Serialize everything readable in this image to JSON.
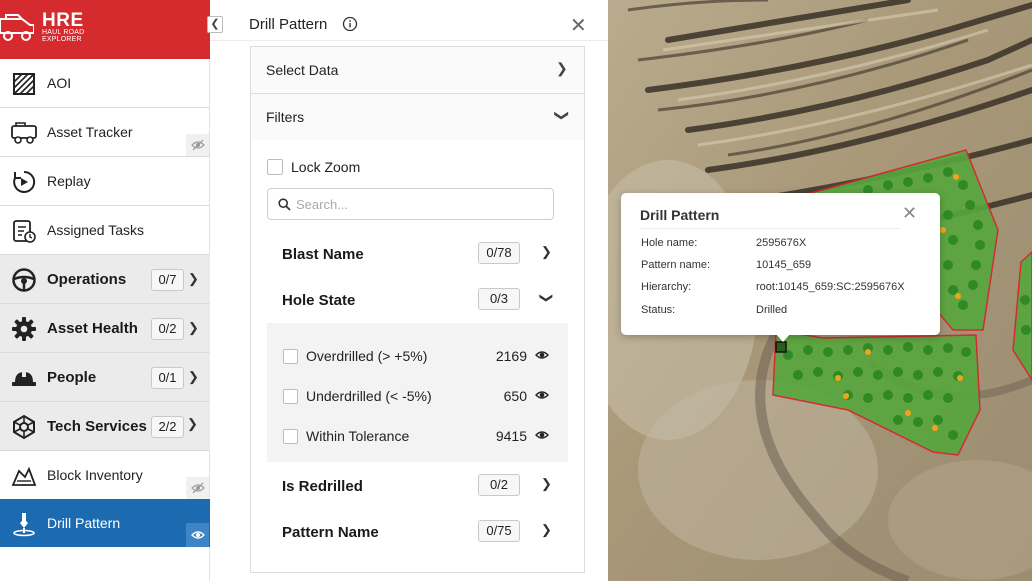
{
  "brand": {
    "name": "HRE",
    "subtitle": "HAUL ROAD EXPLORER"
  },
  "sidebar": {
    "items": [
      {
        "label": "AOI",
        "icon": "aoi-hatch-icon"
      },
      {
        "label": "Asset Tracker",
        "icon": "truck-icon",
        "visibility": "hidden"
      },
      {
        "label": "Replay",
        "icon": "replay-icon"
      },
      {
        "label": "Assigned Tasks",
        "icon": "clipboard-icon"
      },
      {
        "label": "Operations",
        "icon": "steering-wheel-icon",
        "count": "0/7",
        "chevron": "right"
      },
      {
        "label": "Asset Health",
        "icon": "gear-icon",
        "count": "0/2",
        "chevron": "right"
      },
      {
        "label": "People",
        "icon": "hard-hat-icon",
        "count": "0/1",
        "chevron": "right"
      },
      {
        "label": "Tech Services",
        "icon": "tech-services-icon",
        "count": "2/2",
        "chevron": "down"
      },
      {
        "label": "Block Inventory",
        "icon": "block-inventory-icon",
        "visibility": "hidden"
      },
      {
        "label": "Drill Pattern",
        "icon": "drill-icon",
        "visibility": "visible",
        "active": true
      }
    ]
  },
  "panel": {
    "title": "Drill Pattern",
    "select_data": "Select Data",
    "filters": "Filters",
    "lock_zoom": "Lock Zoom",
    "search_placeholder": "Search...",
    "filter_rows": {
      "blast_name": {
        "label": "Blast Name",
        "count": "0/78"
      },
      "hole_state": {
        "label": "Hole State",
        "count": "0/3"
      },
      "is_redrilled": {
        "label": "Is Redrilled",
        "count": "0/2"
      },
      "pattern_name": {
        "label": "Pattern Name",
        "count": "0/75"
      }
    },
    "hole_states": [
      {
        "label": "Overdrilled (> +5%)",
        "value": "2169"
      },
      {
        "label": "Underdrilled (< -5%)",
        "value": "650"
      },
      {
        "label": "Within Tolerance",
        "value": "9415"
      }
    ]
  },
  "popup": {
    "title": "Drill Pattern",
    "fields": {
      "hole_name": {
        "key": "Hole name:",
        "value": "2595676X"
      },
      "pattern_name": {
        "key": "Pattern name:",
        "value": "10145_659"
      },
      "hierarchy": {
        "key": "Hierarchy:",
        "value": "root:10145_659:SC:2595676X"
      },
      "status": {
        "key": "Status:",
        "value": "Drilled"
      }
    }
  },
  "colors": {
    "brand_red": "#d62b2e",
    "active_blue": "#1c6ab0",
    "hole_green": "#3fb23a",
    "hole_orange": "#f2a31b",
    "pattern_outline": "#d8222a"
  }
}
